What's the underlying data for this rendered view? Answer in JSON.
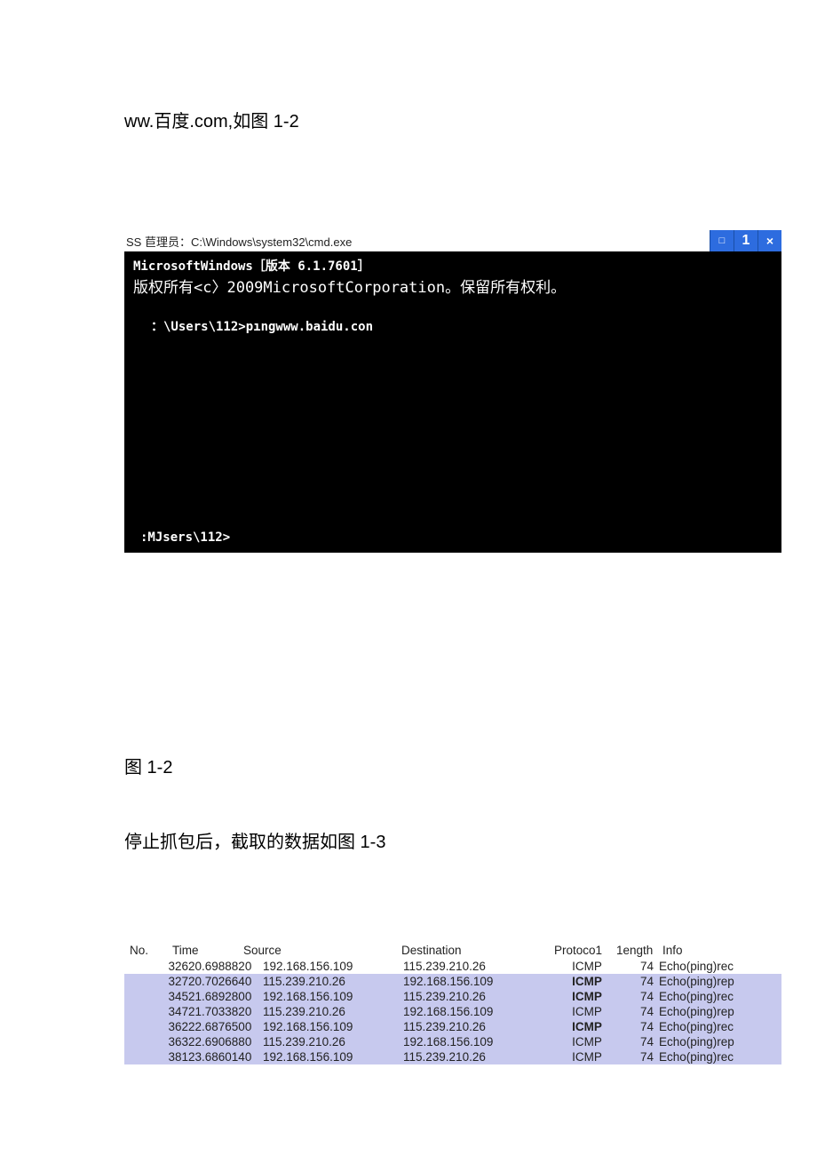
{
  "text": {
    "line1": "ww.百度.com,如图 1-2",
    "fig12": "图 1-2",
    "line2": "停止抓包后，截取的数据如图 1-3"
  },
  "cmd": {
    "title_prefix": "SS 苣理员：",
    "title_path": "C:\\Windows\\system32\\cmd.exe",
    "min_label": "□",
    "max_label": "1",
    "close_label": "×",
    "line1": "MicrosoftWindows［版本 6.1.7601］",
    "line2": "版权所有<c〉2009MicrosoftCorporation。保留所有权利。",
    "line3": "：\\Users\\112>pıngwww.baidu.con",
    "line4": ":MJsers\\112>"
  },
  "table": {
    "headers": {
      "no": "No.",
      "time": "Time",
      "source": "Source",
      "destination": "Destination",
      "protocol": "Protoco1",
      "length": "1ength",
      "info": "Info"
    },
    "rows": [
      {
        "no": "326",
        "time": "20.6988820",
        "source": "192.168.156.109",
        "dest": "115.239.210.26",
        "proto": "ICMP",
        "proto_bold": false,
        "len": "74",
        "info": "Echo(ping)rec",
        "hl": false
      },
      {
        "no": "327",
        "time": "20.7026640",
        "source": "115.239.210.26",
        "dest": "192.168.156.109",
        "proto": "ICMP",
        "proto_bold": true,
        "len": "74",
        "info": "Echo(ping)rep",
        "hl": true
      },
      {
        "no": "345",
        "time": "21.6892800",
        "source": "192.168.156.109",
        "dest": "115.239.210.26",
        "proto": "ICMP",
        "proto_bold": true,
        "len": "74",
        "info": "Echo(ping)rec",
        "hl": true
      },
      {
        "no": "347",
        "time": "21.7033820",
        "source": "115.239.210.26",
        "dest": "192.168.156.109",
        "proto": "ICMP",
        "proto_bold": false,
        "len": "74",
        "info": "Echo(ping)rep",
        "hl": true
      },
      {
        "no": "362",
        "time": "22.6876500",
        "source": "192.168.156.109",
        "dest": "115.239.210.26",
        "proto": "ICMP",
        "proto_bold": true,
        "len": "74",
        "info": "Echo(ping)rec",
        "hl": true
      },
      {
        "no": "363",
        "time": "22.6906880",
        "source": "115.239.210.26",
        "dest": "192.168.156.109",
        "proto": "ICMP",
        "proto_bold": false,
        "len": "74",
        "info": "Echo(ping)rep",
        "hl": true
      },
      {
        "no": "381",
        "time": "23.6860140",
        "source": "192.168.156.109",
        "dest": "115.239.210.26",
        "proto": "ICMP",
        "proto_bold": false,
        "len": "74",
        "info": "Echo(ping)rec",
        "hl": true
      }
    ]
  }
}
